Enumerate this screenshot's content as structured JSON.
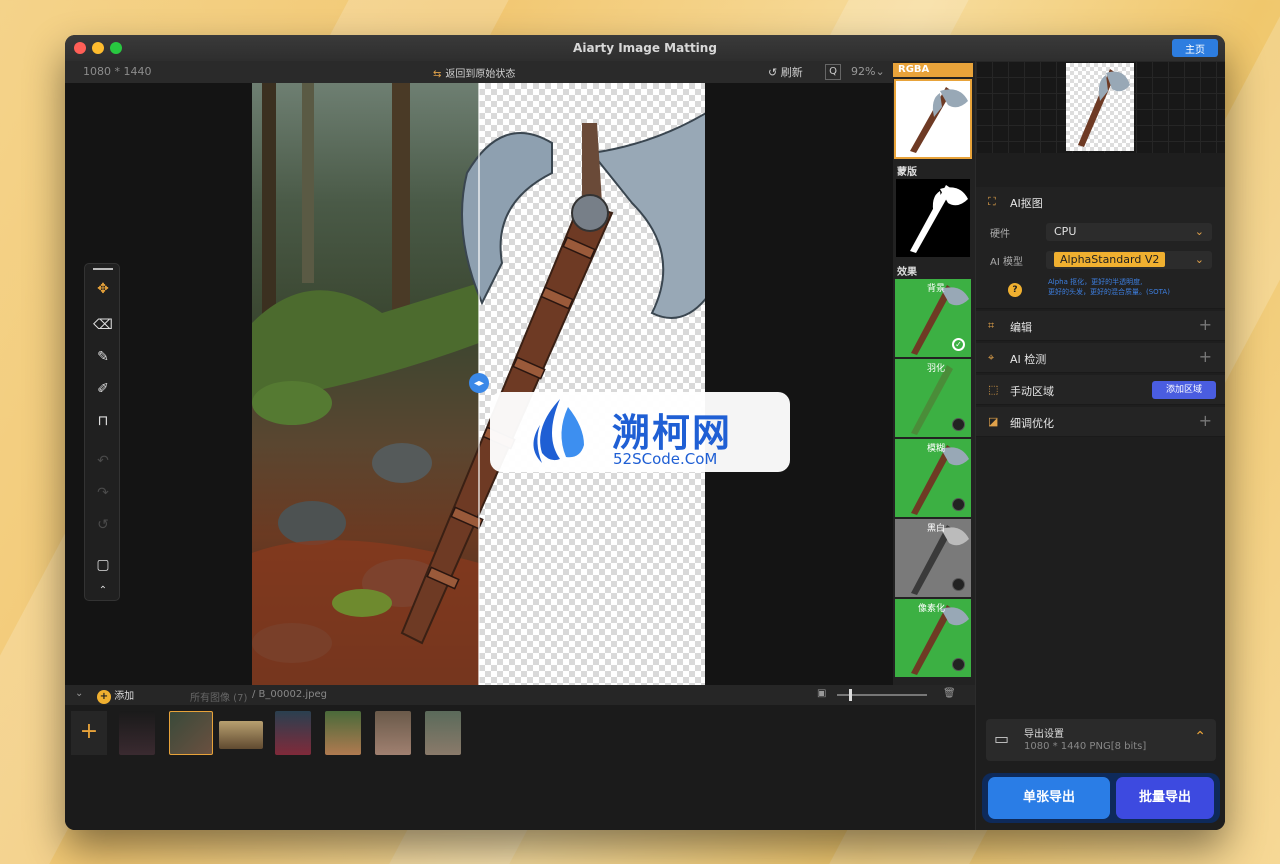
{
  "window": {
    "title": "Aiarty Image Matting",
    "home_button": "主页"
  },
  "toolbar": {
    "dimensions": "1080 * 1440",
    "restore_label": "返回到原始状态",
    "refresh_label": "刷新",
    "zoom": "92%"
  },
  "right_strip": {
    "rgba_label": "RGBA",
    "mask_label": "蒙版",
    "effects_label": "效果",
    "effects": [
      {
        "label": "背景",
        "selected": true
      },
      {
        "label": "羽化",
        "selected": false
      },
      {
        "label": "模糊",
        "selected": false
      },
      {
        "label": "黑白",
        "selected": false
      },
      {
        "label": "像素化",
        "selected": false
      }
    ]
  },
  "side_panel": {
    "ai_matting": {
      "title": "AI抠图",
      "hardware_label": "硬件",
      "hardware_value": "CPU",
      "model_label": "AI 模型",
      "model_value": "AlphaStandard  V2",
      "hint_line1": "Alpha 抠化，更好的半透明度,",
      "hint_line2": "更好的头发，更好的混合质量。(SOTA)"
    },
    "edit": {
      "title": "编辑"
    },
    "ai_detect": {
      "title": "AI 检测"
    },
    "manual_region": {
      "title": "手动区域",
      "add_button": "添加区域"
    },
    "refine": {
      "title": "细调优化"
    },
    "export_settings": {
      "title": "导出设置",
      "value": "1080 * 1440 PNG[8 bits]"
    },
    "export_single": "单张导出",
    "export_batch": "批量导出"
  },
  "filmbar": {
    "add_label": "添加",
    "all_images": "所有图像 (7)",
    "path": "/ B_00002.jpeg"
  },
  "watermark": {
    "title": "溯柯网",
    "subtitle": "52SCode.CoM"
  },
  "colors": {
    "accent": "#e8a33a",
    "primary": "#2a7de6",
    "green_bg": "#3cb043"
  }
}
